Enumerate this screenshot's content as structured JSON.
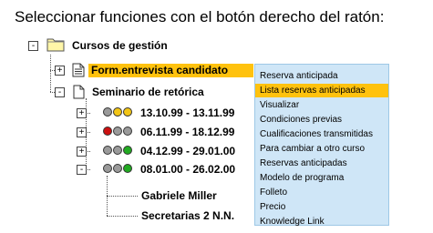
{
  "title": "Seleccionar funciones con el botón derecho del ratón:",
  "tree": {
    "root": {
      "label": "Cursos de gestión",
      "toggle": "-"
    },
    "form_item": {
      "label": "Form.entrevista candidato",
      "toggle": "+"
    },
    "seminar": {
      "label": "Seminario de retórica",
      "toggle": "-"
    },
    "sessions": [
      {
        "dates": "13.10.99 - 13.11.99",
        "toggle": "+",
        "lights": [
          "#9a9a9a",
          "#f2c516",
          "#f2c516"
        ]
      },
      {
        "dates": "06.11.99 - 18.12.99",
        "toggle": "+",
        "lights": [
          "#cc1111",
          "#9a9a9a",
          "#9a9a9a"
        ]
      },
      {
        "dates": "04.12.99 - 29.01.00",
        "toggle": "+",
        "lights": [
          "#9a9a9a",
          "#9a9a9a",
          "#22aa22"
        ]
      },
      {
        "dates": "08.01.00 - 26.02.00",
        "toggle": "-",
        "lights": [
          "#9a9a9a",
          "#9a9a9a",
          "#22aa22"
        ]
      }
    ],
    "participants": [
      "Gabriele Miller",
      "Secretarias  2 N.N."
    ]
  },
  "context_menu": {
    "items": [
      "Reserva anticipada",
      "Lista reservas anticipadas",
      "Visualizar",
      "Condiciones previas",
      "Cualificaciones transmitidas",
      "Para cambiar a otro curso",
      "Reservas anticipadas",
      "Modelo de programa",
      "Folleto",
      "Precio",
      "Knowledge Link"
    ],
    "active_index": 1
  },
  "colors": {
    "highlight": "#ffc20e",
    "menu_background": "#cfe6f7",
    "folder": "#fff6a8"
  }
}
